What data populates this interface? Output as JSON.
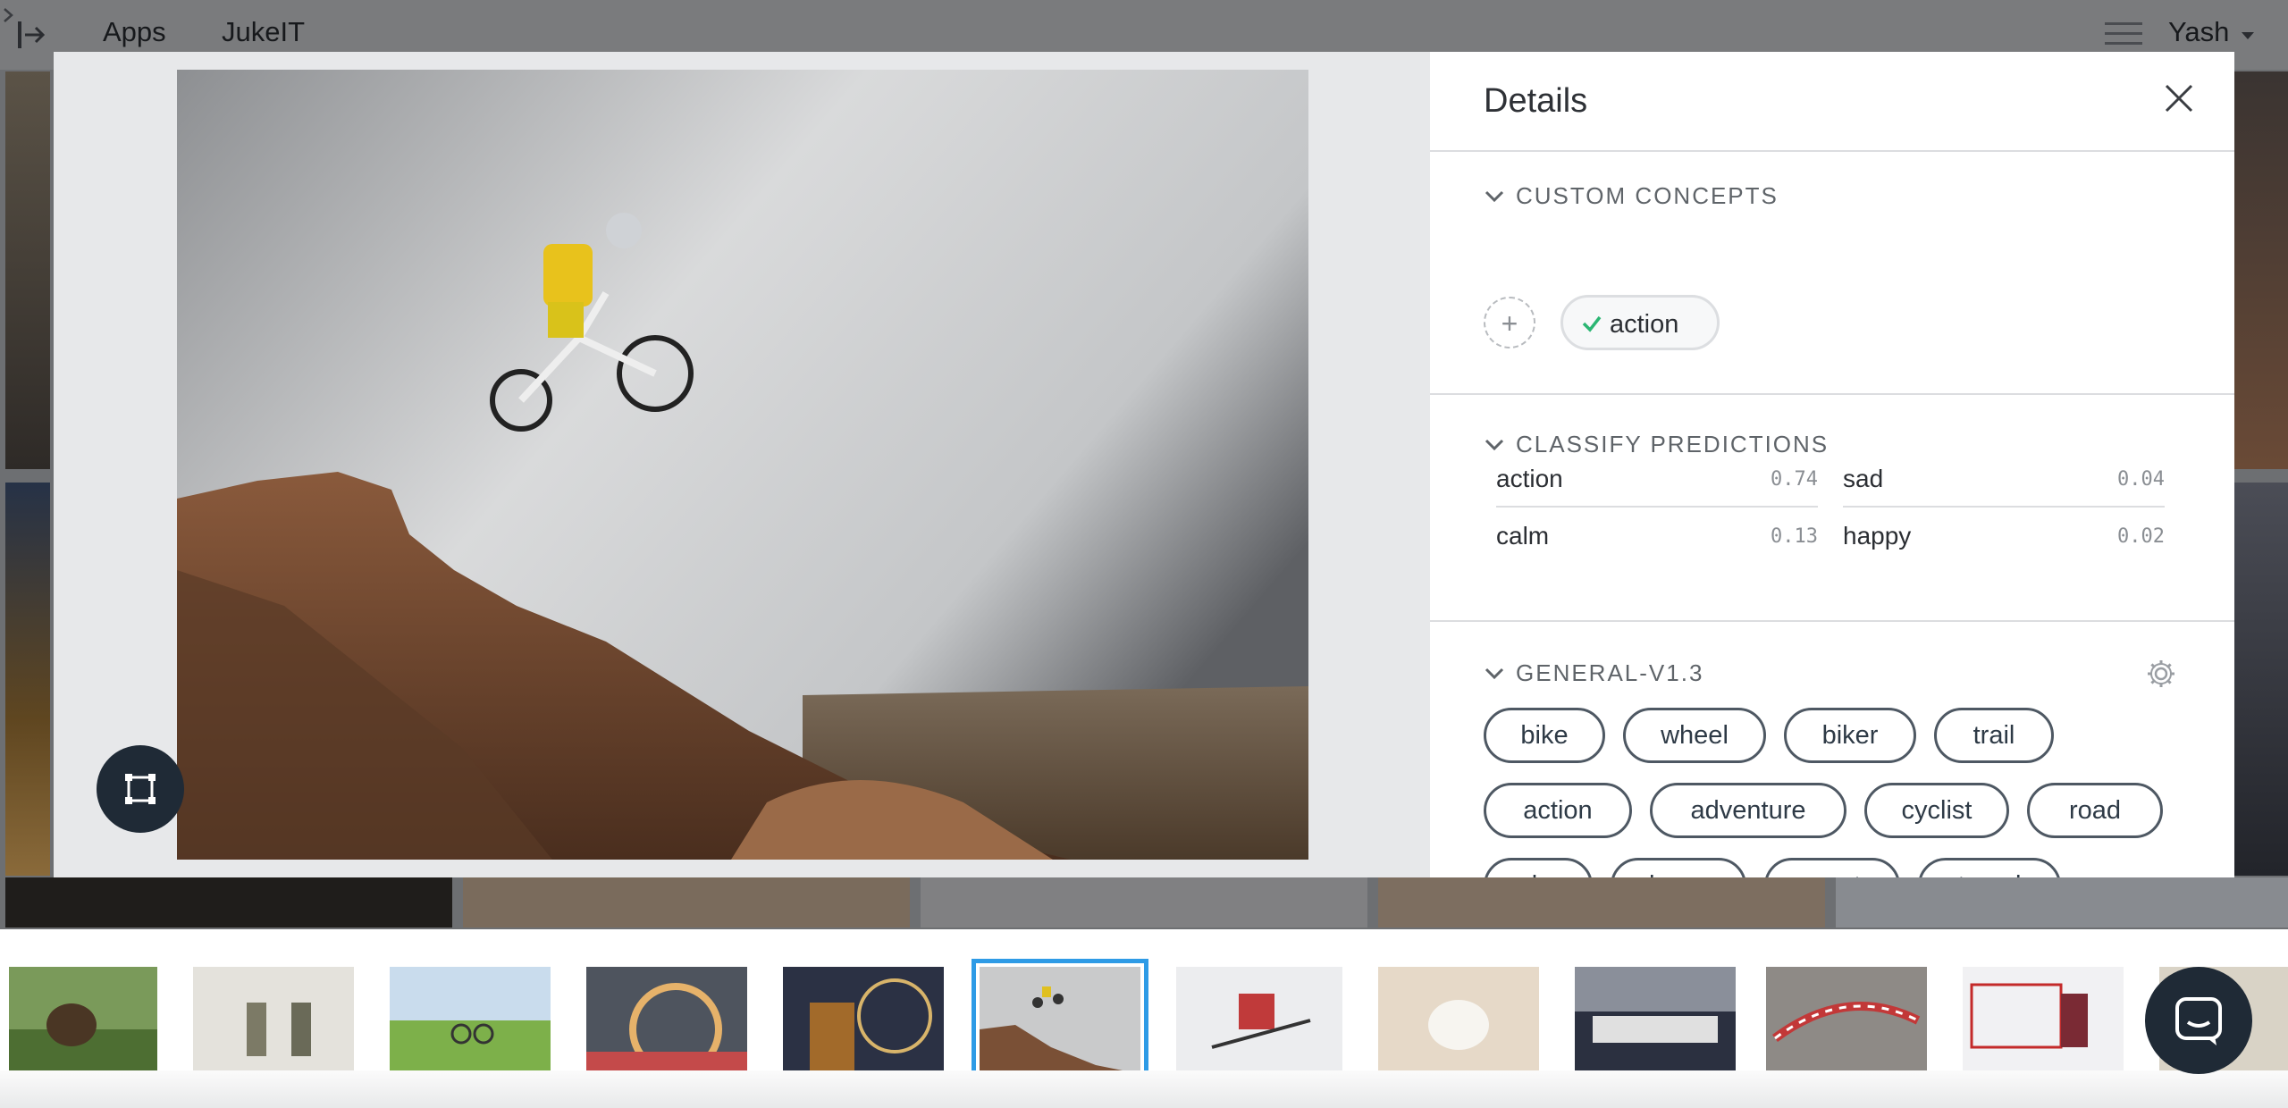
{
  "topbar": {
    "breadcrumb": [
      "Apps",
      "JukeIT"
    ],
    "user": "Yash"
  },
  "details": {
    "title": "Details",
    "sections": {
      "custom": {
        "title": "CUSTOM CONCEPTS",
        "concepts": [
          {
            "label": "action",
            "selected": true
          }
        ]
      },
      "classify": {
        "title": "CLASSIFY PREDICTIONS",
        "predictions": [
          {
            "name": "action",
            "value": "0.74"
          },
          {
            "name": "sad",
            "value": "0.04"
          },
          {
            "name": "calm",
            "value": "0.13"
          },
          {
            "name": "happy",
            "value": "0.02"
          }
        ]
      },
      "general": {
        "title": "GENERAL-V1.3",
        "tags": [
          "bike",
          "wheel",
          "biker",
          "trail",
          "action",
          "adventure",
          "cyclist",
          "road",
          "sky",
          "hurry",
          "sport",
          "travel"
        ]
      }
    }
  },
  "filmstrip": {
    "thumbnails": [
      "dog",
      "soldiers",
      "cyclist-field",
      "ferris-wheel",
      "carnival-night",
      "mountain-biker",
      "skier",
      "white-dog",
      "rugby-scrum",
      "kart-track",
      "hockey"
    ],
    "selected_index": 5
  },
  "colors": {
    "accent": "#2e9be6",
    "dark": "#1f2a36",
    "check": "#2bb673"
  }
}
